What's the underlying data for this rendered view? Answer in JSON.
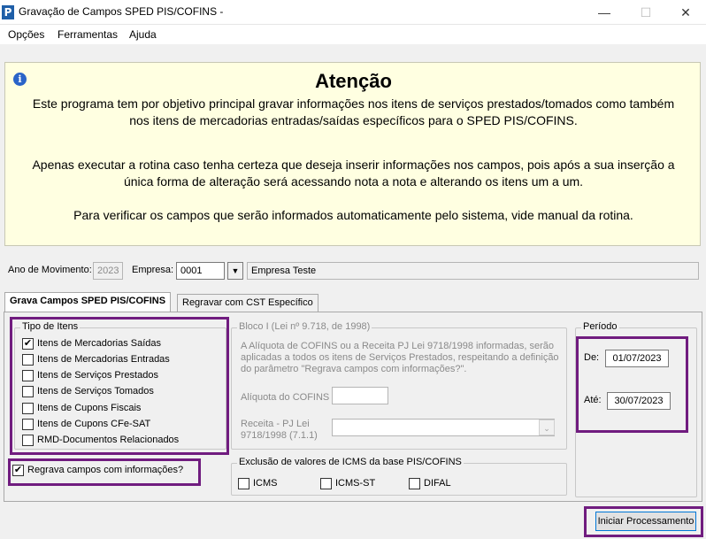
{
  "window": {
    "title": "Gravação de Campos SPED PIS/COFINS -",
    "minimize_glyph": "—",
    "maximize_glyph": "☐",
    "close_glyph": "✕"
  },
  "menu": {
    "items": [
      "Opções",
      "Ferramentas",
      "Ajuda"
    ]
  },
  "notice": {
    "title": "Atenção",
    "lines": [
      "Este programa tem por objetivo principal gravar informações nos itens de serviços prestados/tomados como também",
      "nos itens de mercadorias entradas/saídas específicos para o SPED PIS/COFINS.",
      "Apenas executar a rotina caso tenha certeza que deseja inserir informações nos campos, pois após a sua inserção a",
      "única forma de alteração será acessando nota a nota e alterando os itens um a um.",
      "Para verificar os campos que serão informados automaticamente pelo sistema, vide manual da rotina."
    ]
  },
  "top_fields": {
    "ano_label": "Ano de Movimento:",
    "ano_value": "2023",
    "empresa_label": "Empresa:",
    "empresa_code": "0001",
    "empresa_name": "Empresa Teste"
  },
  "tabs": [
    {
      "label": "Grava Campos SPED PIS/COFINS",
      "active": true
    },
    {
      "label": "Regravar com CST Específico",
      "active": false
    }
  ],
  "tipo_itens": {
    "title": "Tipo de Itens",
    "items": [
      {
        "label": "Itens de Mercadorias Saídas",
        "checked": true
      },
      {
        "label": "Itens de Mercadorias Entradas",
        "checked": false
      },
      {
        "label": "Itens de Serviços Prestados",
        "checked": false
      },
      {
        "label": "Itens de Serviços Tomados",
        "checked": false
      },
      {
        "label": "Itens de Cupons Fiscais",
        "checked": false
      },
      {
        "label": "Itens de Cupons CFe-SAT",
        "checked": false
      },
      {
        "label": "RMD-Documentos Relacionados",
        "checked": false
      }
    ]
  },
  "regrava": {
    "label": "Regrava campos com informações?",
    "checked": true
  },
  "bloco": {
    "title": "Bloco I (Lei nº 9.718, de 1998)",
    "description_lines": [
      "A Alíquota de COFINS ou a Receita PJ Lei 9718/1998 informadas, serão",
      "aplicadas a todos os itens de Serviços Prestados, respeitando a definição",
      "do parâmetro \"Regrava campos com informações?\"."
    ],
    "aliquota_label": "Alíquota do COFINS",
    "aliquota_value": "",
    "receita_label_1": "Receita - PJ Lei",
    "receita_label_2": "9718/1998 (7.1.1)",
    "receita_value": ""
  },
  "exclusao": {
    "title": "Exclusão de valores de ICMS da base PIS/COFINS",
    "items": [
      {
        "label": "ICMS",
        "checked": false
      },
      {
        "label": "ICMS-ST",
        "checked": false
      },
      {
        "label": "DIFAL",
        "checked": false
      }
    ]
  },
  "periodo": {
    "title": "Período",
    "de_label": "De:",
    "de_value": "01/07/2023",
    "ate_label": "Até:",
    "ate_value": "30/07/2023"
  },
  "actions": {
    "start_label": "Iniciar Processamento"
  },
  "colors": {
    "highlight": "#701c7f",
    "notice_bg": "#ffffe1",
    "accent": "#0078d7"
  }
}
